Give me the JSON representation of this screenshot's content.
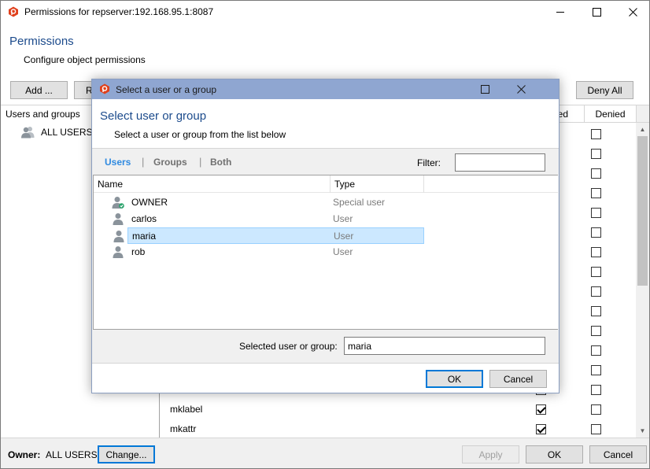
{
  "window": {
    "title": "Permissions for repserver:192.168.95.1:8087",
    "header_title": "Permissions",
    "header_subtitle": "Configure object permissions"
  },
  "toolbar": {
    "add_label": "Add ...",
    "remove_label_partial": "R",
    "deny_all_label": "Deny All"
  },
  "left_pane": {
    "header": "Users and groups",
    "items": [
      {
        "label": "ALL USERS"
      }
    ]
  },
  "permissions": {
    "columns": [
      "ed",
      "Denied"
    ],
    "rows": [
      {
        "label": "",
        "allowed": false,
        "denied": false
      },
      {
        "label": "",
        "allowed": false,
        "denied": false
      },
      {
        "label": "",
        "allowed": false,
        "denied": false
      },
      {
        "label": "",
        "allowed": false,
        "denied": false
      },
      {
        "label": "",
        "allowed": false,
        "denied": false
      },
      {
        "label": "",
        "allowed": false,
        "denied": false
      },
      {
        "label": "",
        "allowed": false,
        "denied": false
      },
      {
        "label": "",
        "allowed": false,
        "denied": false
      },
      {
        "label": "",
        "allowed": false,
        "denied": false
      },
      {
        "label": "",
        "allowed": false,
        "denied": false
      },
      {
        "label": "",
        "allowed": false,
        "denied": false
      },
      {
        "label": "",
        "allowed": false,
        "denied": false
      },
      {
        "label": "",
        "allowed": false,
        "denied": false
      },
      {
        "label": "",
        "allowed": false,
        "denied": false
      },
      {
        "label": "mklabel",
        "allowed": true,
        "denied": false
      },
      {
        "label": "mkattr",
        "allowed": true,
        "denied": false
      }
    ]
  },
  "footer": {
    "owner_label": "Owner:",
    "owner_value": "ALL USERS",
    "change_label": "Change...",
    "apply_label": "Apply",
    "ok_label": "OK",
    "cancel_label": "Cancel"
  },
  "dialog": {
    "title": "Select a user or a group",
    "header_title": "Select user or group",
    "header_subtitle": "Select a user or group from the list below",
    "tabs": [
      {
        "label": "Users",
        "active": true
      },
      {
        "label": "Groups",
        "active": false
      },
      {
        "label": "Both",
        "active": false
      }
    ],
    "filter_label": "Filter:",
    "filter_value": "",
    "columns": {
      "name": "Name",
      "type": "Type"
    },
    "rows": [
      {
        "name": "OWNER",
        "type": "Special user",
        "icon": "owner-user-icon",
        "selected": false
      },
      {
        "name": "carlos",
        "type": "User",
        "icon": "user-icon",
        "selected": false
      },
      {
        "name": "maria",
        "type": "User",
        "icon": "user-icon",
        "selected": true
      },
      {
        "name": "rob",
        "type": "User",
        "icon": "user-icon",
        "selected": false
      }
    ],
    "selected_label": "Selected user or group:",
    "selected_value": "maria",
    "ok_label": "OK",
    "cancel_label": "Cancel"
  },
  "colors": {
    "accent_blue": "#1c4b8c",
    "dialog_titlebar": "#8fa6d1",
    "active_tab": "#2f8ae0",
    "selection": "#cce8ff",
    "app_icon": "#e0401c"
  }
}
